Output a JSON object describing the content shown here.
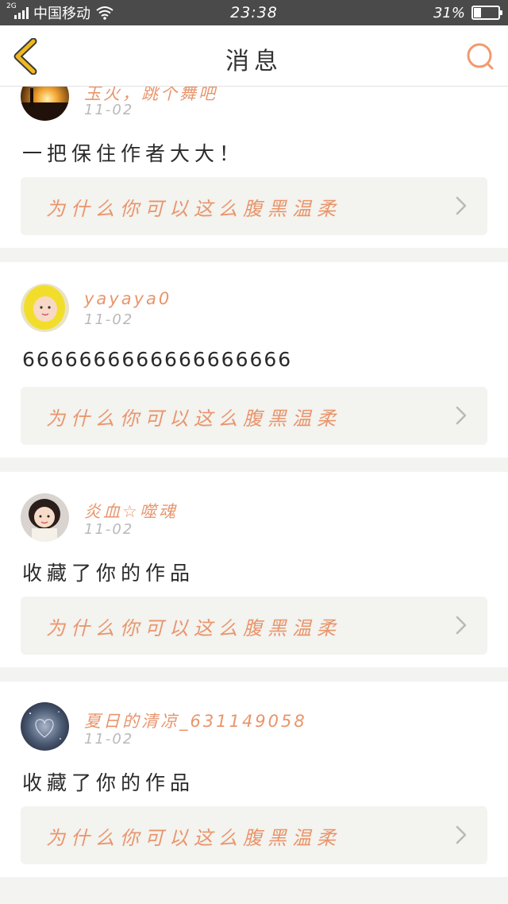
{
  "status_bar": {
    "network": "2G",
    "carrier": "中国移动",
    "time": "23:38",
    "battery": "31%",
    "battery_level": 0.31
  },
  "header": {
    "title": "消息",
    "back_icon": "chevron-left-icon",
    "search_icon": "search-icon"
  },
  "colors": {
    "accent": "#e9956c",
    "back_icon": "#f1b81e",
    "search_icon": "#f29a6c",
    "link_bg": "#f3f3ef"
  },
  "messages": [
    {
      "username": "玉火，跳个舞吧",
      "date": "11-02",
      "content": "一把保住作者大大！",
      "link_title": "为什么你可以这么腹黑温柔"
    },
    {
      "username": "yayaya0",
      "date": "11-02",
      "content": "6666666666666666666",
      "link_title": "为什么你可以这么腹黑温柔"
    },
    {
      "username": "炎血☆噬魂",
      "date": "11-02",
      "content": "收藏了你的作品",
      "link_title": "为什么你可以这么腹黑温柔"
    },
    {
      "username": "夏日的清凉_631149058",
      "date": "11-02",
      "content": "收藏了你的作品",
      "link_title": "为什么你可以这么腹黑温柔"
    }
  ]
}
